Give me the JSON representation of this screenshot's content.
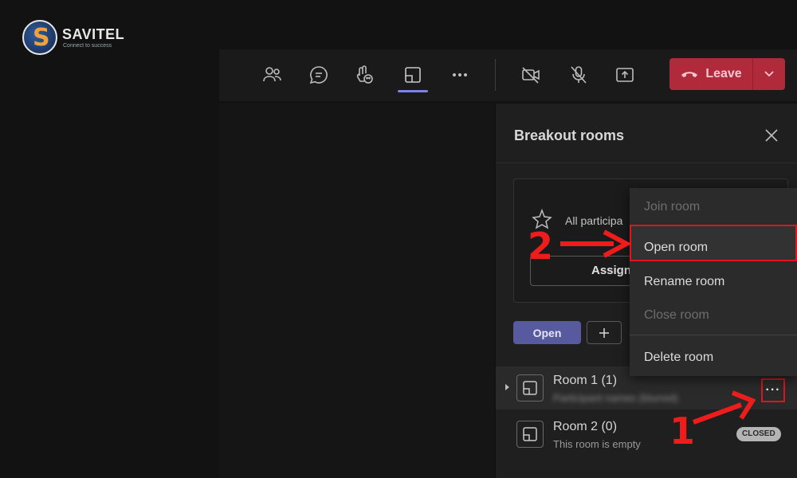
{
  "logo": {
    "brand": "SAVITEL",
    "slogan": "Connect to success",
    "mark": "S"
  },
  "toolbar": {
    "buttons": [
      "people-icon",
      "chat-icon",
      "react-icon",
      "rooms-icon",
      "more-icon",
      "camera-off-icon",
      "mic-off-icon",
      "share-icon"
    ],
    "leave_label": "Leave"
  },
  "panel": {
    "title": "Breakout rooms",
    "assign_text": "All participa",
    "assign_button": "Assign",
    "open_button": "Open",
    "rooms": [
      {
        "name": "Room 1 (1)",
        "subtitle": "Participant names (blurred)"
      },
      {
        "name": "Room 2 (0)",
        "subtitle": "This room is empty",
        "badge": "CLOSED"
      }
    ]
  },
  "menu": {
    "items": [
      {
        "label": "Join room",
        "enabled": false
      },
      {
        "label": "Open room",
        "enabled": true
      },
      {
        "label": "Rename room",
        "enabled": true
      },
      {
        "label": "Close room",
        "enabled": false
      },
      {
        "label": "Delete room",
        "enabled": true
      }
    ]
  },
  "annotations": {
    "step1": "1",
    "step2": "2"
  },
  "colors": {
    "accent": "#7b83eb",
    "leave": "#b02a3c",
    "highlight": "#e0141e"
  }
}
